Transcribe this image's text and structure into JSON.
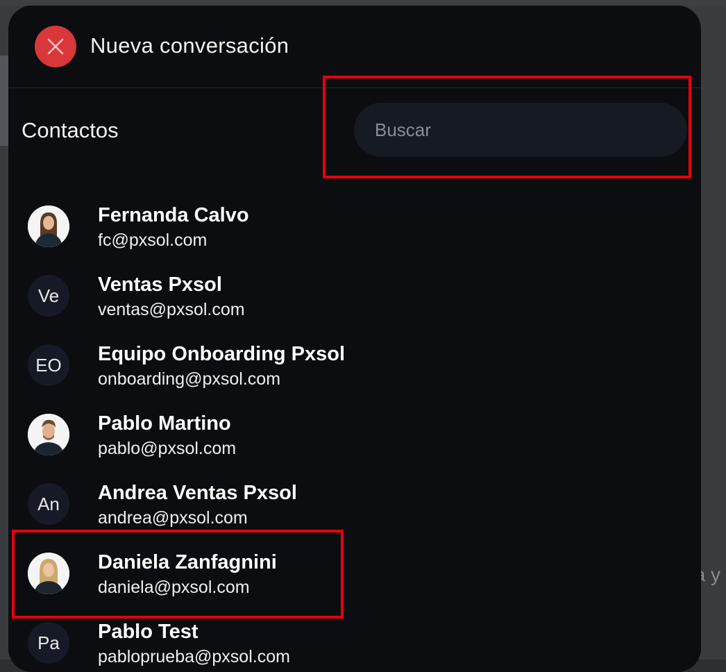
{
  "header": {
    "title": "Nueva conversación",
    "close_icon": "close-icon"
  },
  "contacts": {
    "label": "Contactos",
    "search_placeholder": "Buscar"
  },
  "background_text": "a y",
  "colors": {
    "panel": "#0b0d10",
    "close_button": "#d9373a",
    "search_bg": "#161a22",
    "highlight": "#e8000c",
    "avatar_bg": "#161a26"
  },
  "list": [
    {
      "name": "Fernanda Calvo",
      "email": "fc@pxsol.com",
      "avatar": "photo",
      "initials": ""
    },
    {
      "name": "Ventas Pxsol",
      "email": "ventas@pxsol.com",
      "avatar": "initials",
      "initials": "Ve"
    },
    {
      "name": "Equipo Onboarding Pxsol",
      "email": "onboarding@pxsol.com",
      "avatar": "initials",
      "initials": "EO"
    },
    {
      "name": "Pablo Martino",
      "email": "pablo@pxsol.com",
      "avatar": "photo",
      "initials": ""
    },
    {
      "name": "Andrea Ventas Pxsol",
      "email": "andrea@pxsol.com",
      "avatar": "initials",
      "initials": "An"
    },
    {
      "name": "Daniela Zanfagnini",
      "email": "daniela@pxsol.com",
      "avatar": "photo",
      "initials": ""
    },
    {
      "name": "Pablo Test",
      "email": "pabloprueba@pxsol.com",
      "avatar": "initials",
      "initials": "Pa"
    }
  ]
}
